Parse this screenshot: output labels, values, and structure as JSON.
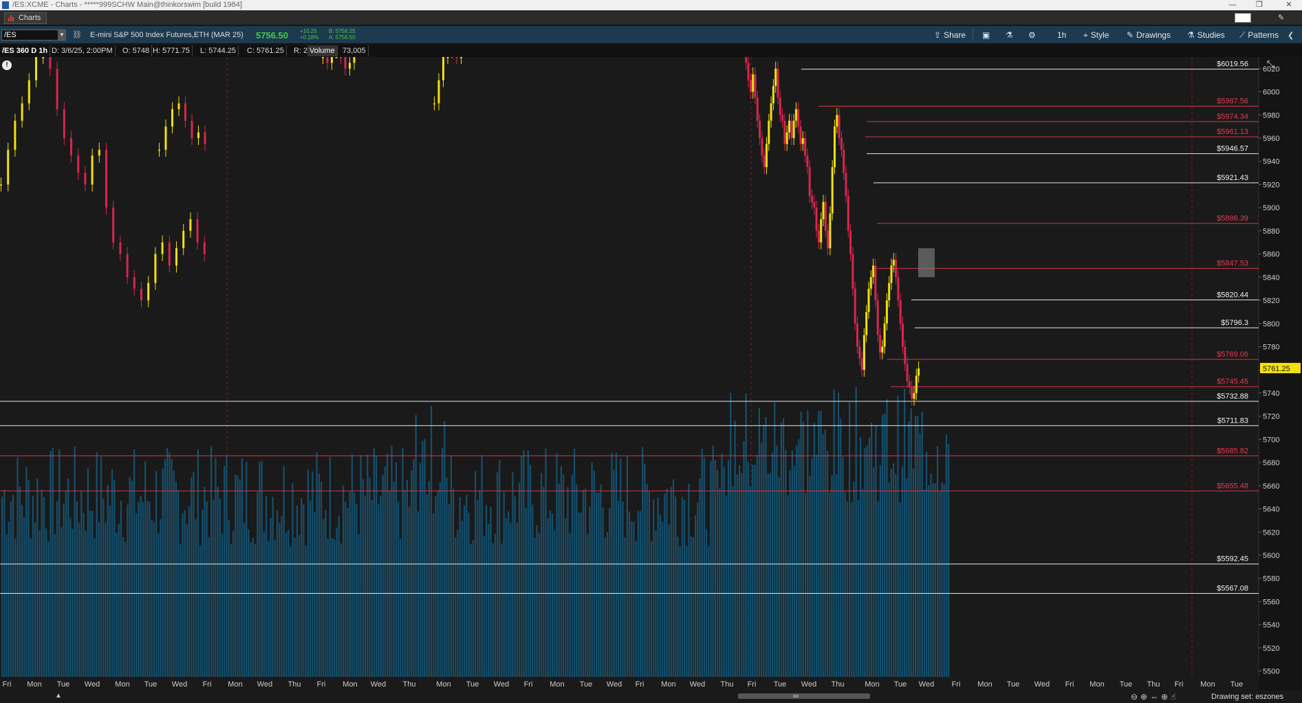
{
  "window": {
    "title": "/ES:XCME - Charts - *****999SCHW Main@thinkorswim [build 1984]",
    "buttons": [
      "—",
      "❐",
      "✕"
    ]
  },
  "tabbar": {
    "tab_label": "Charts"
  },
  "toolbar": {
    "symbol": "/ES",
    "description": "E-mini S&P 500 Index Futures,ETH (MAR 25)",
    "last_price": "5756.50",
    "net_change": "+10.25",
    "pct_change": "+0.18%",
    "bid": "B: 5756.25",
    "ask": "A: 5756.50",
    "share_label": "Share",
    "timeframe_label": "1h",
    "style_label": "Style",
    "drawings_label": "Drawings",
    "studies_label": "Studies",
    "patterns_label": "Patterns",
    "accent_color": "#3ecf3e"
  },
  "infobar": {
    "symbol": "/ES 360 D 1h",
    "date": "D: 3/6/25, 2:00PM",
    "open": "O: 5748",
    "high": "H: 5771.75",
    "low": "L: 5744.25",
    "close": "C: 5761.25",
    "range": "R: 27.5",
    "volume_label": "Volume",
    "volume_value": "73,005"
  },
  "chart_data": {
    "type": "candlestick",
    "title": "/ES 360 D 1h",
    "ylim": [
      5495,
      6030
    ],
    "y_ticks": [
      "6020",
      "6000",
      "5980",
      "5960",
      "5940",
      "5920",
      "5900",
      "5880",
      "5860",
      "5840",
      "5820",
      "5800",
      "5780",
      "5760",
      "5740",
      "5720",
      "5700",
      "5680",
      "5660",
      "5640",
      "5620",
      "5600",
      "5580",
      "5560",
      "5540",
      "5520",
      "5500"
    ],
    "x_labels": [
      "Fri",
      "Mon",
      "Tue",
      "Wed",
      "Mon",
      "Tue",
      "Wed",
      "Fri",
      "Mon",
      "Wed",
      "Thu",
      "Fri",
      "Mon",
      "Wed",
      "Thu",
      "Mon",
      "Tue",
      "Wed",
      "Fri",
      "Mon",
      "Tue",
      "Wed",
      "Fri",
      "Mon",
      "Wed",
      "Thu",
      "Fri",
      "Tue",
      "Wed",
      "Thu",
      "Mon",
      "Tue",
      "Wed",
      "Fri",
      "Mon",
      "Tue",
      "Wed",
      "Fri",
      "Mon",
      "Tue",
      "Thu",
      "Fri",
      "Mon",
      "Tue"
    ],
    "current_price_label": "5761.25",
    "price_levels": [
      {
        "value": 6019.56,
        "label": "$6019.56",
        "color": "white"
      },
      {
        "value": 5987.56,
        "label": "$5987.56",
        "color": "red"
      },
      {
        "value": 5974.34,
        "label": "$5974.34",
        "color": "red"
      },
      {
        "value": 5961.13,
        "label": "$5961.13",
        "color": "red"
      },
      {
        "value": 5946.57,
        "label": "$5946.57",
        "color": "white"
      },
      {
        "value": 5921.43,
        "label": "$5921.43",
        "color": "white"
      },
      {
        "value": 5886.39,
        "label": "$5886.39",
        "color": "red"
      },
      {
        "value": 5847.53,
        "label": "$5847.53",
        "color": "red"
      },
      {
        "value": 5820.44,
        "label": "$5820.44",
        "color": "white"
      },
      {
        "value": 5796.3,
        "label": "$5796.3",
        "color": "white"
      },
      {
        "value": 5769.06,
        "label": "$5769.06",
        "color": "red"
      },
      {
        "value": 5745.45,
        "label": "$5745.45",
        "color": "red"
      },
      {
        "value": 5732.88,
        "label": "$5732.88",
        "color": "white"
      },
      {
        "value": 5711.83,
        "label": "$5711.83",
        "color": "white"
      },
      {
        "value": 5685.82,
        "label": "$5685.82",
        "color": "red"
      },
      {
        "value": 5655.48,
        "label": "$5655.48",
        "color": "red"
      },
      {
        "value": 5592.45,
        "label": "$5592.45",
        "color": "white"
      },
      {
        "value": 5567.08,
        "label": "$5567.08",
        "color": "white"
      }
    ],
    "series": [
      {
        "name": "segment-1",
        "values": [
          5920,
          5950,
          5975,
          5990,
          6010,
          6030,
          6040,
          6020,
          5985,
          5960,
          5945,
          5930,
          5920,
          5945,
          5950,
          5900,
          5870,
          5860,
          5840,
          5830,
          5820,
          5835,
          5860,
          5870,
          5850,
          5865,
          5880,
          5890,
          5870,
          5860
        ]
      },
      {
        "name": "segment-2",
        "values": [
          5950,
          5970,
          5985,
          5990,
          5975,
          5960,
          5965,
          5955
        ]
      },
      {
        "name": "segment-3",
        "values": [
          6030,
          6025,
          6035,
          6040,
          6030,
          6020,
          6025,
          6035
        ]
      },
      {
        "name": "segment-4",
        "values": [
          5990,
          6010,
          6030,
          6040,
          6035,
          6030,
          6040
        ]
      },
      {
        "name": "segment-5",
        "values": [
          6040,
          6025,
          6010,
          6000,
          6015,
          5995,
          5975,
          5960,
          5945,
          5935,
          5955,
          5975,
          5990,
          6005,
          6020,
          5995,
          5980,
          5975,
          5955,
          5965,
          5975,
          5960,
          5975,
          5985,
          5970,
          5955,
          5960,
          5945,
          5935,
          5910,
          5905,
          5900,
          5880,
          5870,
          5890,
          5905,
          5880,
          5865,
          5895,
          5935,
          5970,
          5980,
          5960,
          5950,
          5930,
          5910,
          5880,
          5860,
          5830,
          5800,
          5780,
          5770,
          5760,
          5790,
          5810,
          5830,
          5840,
          5850,
          5820,
          5790,
          5775,
          5780,
          5800,
          5820,
          5835,
          5850,
          5855,
          5840,
          5820,
          5800,
          5780,
          5765,
          5750,
          5745,
          5735,
          5740,
          5755,
          5761.25
        ]
      }
    ],
    "volume": {
      "label": "Volume",
      "value": "73,005"
    }
  },
  "status": {
    "drawing_set": "Drawing set: eszones"
  }
}
